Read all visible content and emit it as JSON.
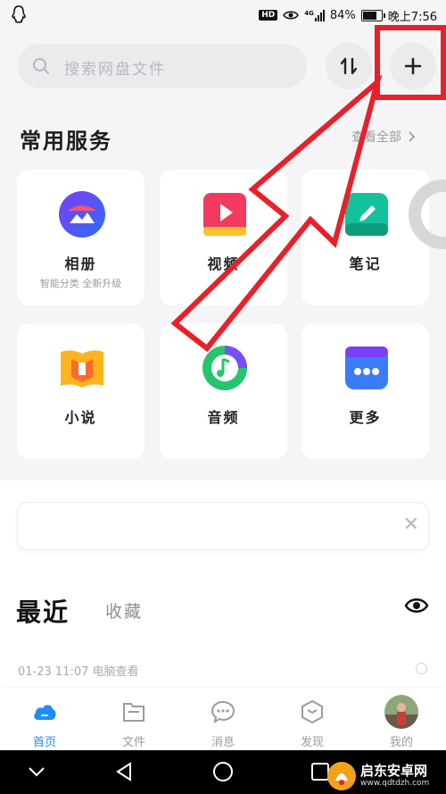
{
  "status_bar": {
    "hd_badge": "HD",
    "signal_label": "4G",
    "battery_percent": "84%",
    "battery_level": 0.84,
    "time": "晚上7:56"
  },
  "search": {
    "placeholder": "搜索网盘文件"
  },
  "header_buttons": [
    "sort-icon",
    "plus-icon"
  ],
  "services": {
    "title": "常用服务",
    "view_all": "查看全部",
    "items": [
      {
        "label": "相册",
        "sub": "智能分类 全新升级",
        "icon": "album-icon",
        "color": "#2f6df6"
      },
      {
        "label": "视频",
        "sub": "",
        "icon": "video-icon",
        "color": "#f23a5e"
      },
      {
        "label": "笔记",
        "sub": "",
        "icon": "note-icon",
        "color": "#13c29a"
      },
      {
        "label": "小说",
        "sub": "",
        "icon": "novel-icon",
        "color": "#ffb31e"
      },
      {
        "label": "音频",
        "sub": "",
        "icon": "audio-icon",
        "color": "#27c46f"
      },
      {
        "label": "更多",
        "sub": "",
        "icon": "more-icon",
        "color": "#3a7cf6"
      }
    ]
  },
  "recent": {
    "tab_recent": "最近",
    "tab_favorites": "收藏",
    "first_item": "01-23 11:07 电脑查看"
  },
  "bottom_nav": [
    {
      "label": "首页",
      "icon": "home-cloud-icon",
      "active": true
    },
    {
      "label": "文件",
      "icon": "folder-icon",
      "active": false
    },
    {
      "label": "消息",
      "icon": "message-icon",
      "active": false
    },
    {
      "label": "发现",
      "icon": "discover-icon",
      "active": false
    },
    {
      "label": "我的",
      "icon": "avatar",
      "active": false
    }
  ],
  "watermark": {
    "title": "启东安卓网",
    "url": "www.qdtdzh.com"
  },
  "colors": {
    "accent": "#1e8ef5",
    "annotation": "#e8202a"
  }
}
